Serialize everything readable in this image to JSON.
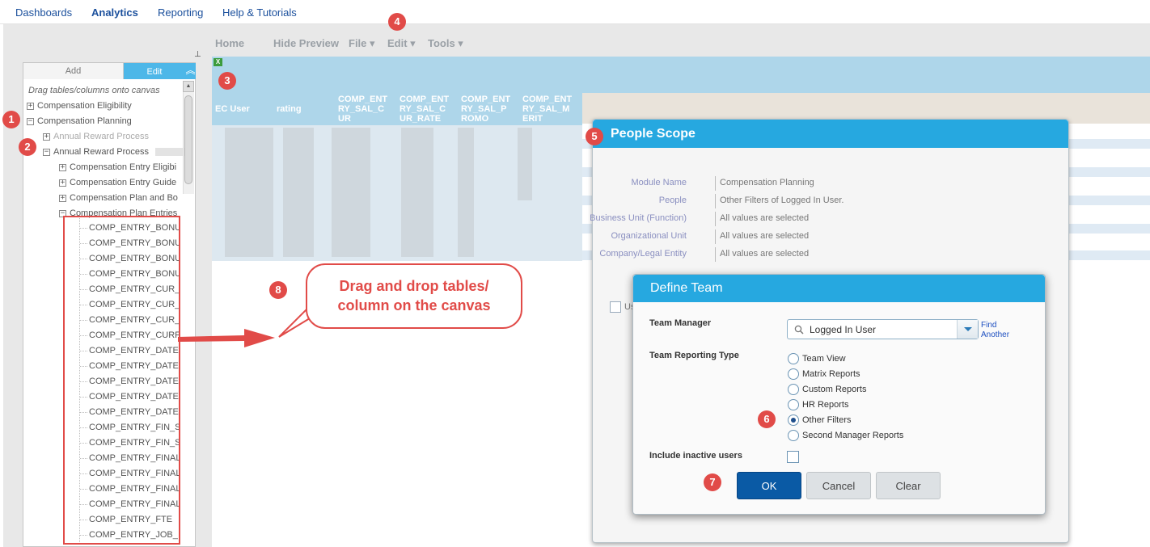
{
  "topnav": {
    "items": [
      "Dashboards",
      "Analytics",
      "Reporting",
      "Help & Tutorials"
    ],
    "active": "Analytics"
  },
  "toolbar": {
    "home": "Home",
    "hide_preview": "Hide Preview",
    "file": "File ▾",
    "edit": "Edit ▾",
    "tools": "Tools ▾"
  },
  "left_panel": {
    "tab_add": "Add",
    "tab_edit": "Edit",
    "hint": "Drag tables/columns onto canvas",
    "tree": [
      {
        "label": "Compensation Eligibility",
        "toggle": "+"
      },
      {
        "label": "Compensation Planning",
        "toggle": "−"
      },
      {
        "label": "Annual Reward Process",
        "toggle": "+"
      },
      {
        "label": "Annual Reward Process",
        "toggle": "−"
      },
      {
        "label": "Compensation Entry Eligibi",
        "toggle": "+"
      },
      {
        "label": "Compensation Entry Guide",
        "toggle": "+"
      },
      {
        "label": "Compensation Plan and Bo",
        "toggle": "+"
      },
      {
        "label": "Compensation Plan Entries",
        "toggle": "−"
      }
    ],
    "columns": [
      "COMP_ENTRY_BONU",
      "COMP_ENTRY_BONU",
      "COMP_ENTRY_BONU",
      "COMP_ENTRY_BONU",
      "COMP_ENTRY_CUR_",
      "COMP_ENTRY_CUR_",
      "COMP_ENTRY_CUR_",
      "COMP_ENTRY_CURF",
      "COMP_ENTRY_DATE",
      "COMP_ENTRY_DATE",
      "COMP_ENTRY_DATE",
      "COMP_ENTRY_DATE",
      "COMP_ENTRY_DATE",
      "COMP_ENTRY_FIN_S",
      "COMP_ENTRY_FIN_S",
      "COMP_ENTRY_FINAL",
      "COMP_ENTRY_FINAL",
      "COMP_ENTRY_FINAL",
      "COMP_ENTRY_FINAL",
      "COMP_ENTRY_FTE",
      "COMP_ENTRY_JOB_"
    ]
  },
  "grid": {
    "headers": [
      [
        "EC User"
      ],
      [
        "rating"
      ],
      [
        "COMP_ENT",
        "RY_SAL_C",
        "UR"
      ],
      [
        "COMP_ENT",
        "RY_SAL_C",
        "UR_RATE"
      ],
      [
        "COMP_ENT",
        "RY_SAL_P",
        "ROMO"
      ],
      [
        "COMP_ENT",
        "RY_SAL_M",
        "ERIT"
      ]
    ]
  },
  "people_scope": {
    "title": "People Scope",
    "rows": [
      {
        "label": "Module Name",
        "value": "Compensation Planning"
      },
      {
        "label": "People",
        "value": "Other Filters of Logged In User."
      },
      {
        "label": "Business Unit (Function)",
        "value": "All values are selected"
      },
      {
        "label": "Organizational Unit",
        "value": "All values are selected"
      },
      {
        "label": "Company/Legal Entity",
        "value": "All values are selected"
      }
    ],
    "checkbox_label": "Us"
  },
  "define_team": {
    "title": "Define Team",
    "team_manager_label": "Team Manager",
    "team_manager_value": "Logged In User",
    "find_another": [
      "Find",
      "Another"
    ],
    "reporting_type_label": "Team Reporting Type",
    "options": [
      "Team View",
      "Matrix Reports",
      "Custom Reports",
      "HR Reports",
      "Other Filters",
      "Second Manager Reports"
    ],
    "selected_option": "Other Filters",
    "include_inactive_label": "Include inactive users",
    "ok": "OK",
    "cancel": "Cancel",
    "clear": "Clear"
  },
  "annotations": {
    "badges": [
      "1",
      "2",
      "3",
      "4",
      "5",
      "6",
      "7",
      "8"
    ],
    "callout": [
      "Drag and drop tables/",
      "column on the canvas"
    ],
    "accent": "#e14b48"
  },
  "colors": {
    "dialog_header": "#26a8e0",
    "ok_button": "#0a5aa5",
    "canvas_header": "#aed6ea"
  }
}
